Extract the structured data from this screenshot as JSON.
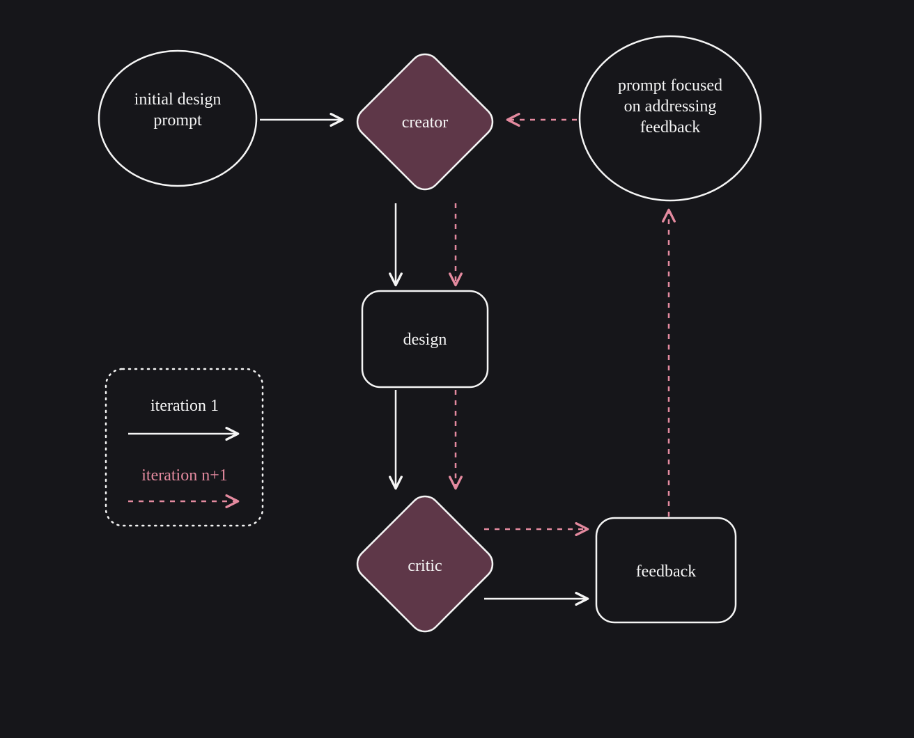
{
  "diagram": {
    "type": "flowchart",
    "background": "#16161a",
    "colors": {
      "stroke": "#f5f5f5",
      "accent_fill": "#5e3748",
      "dashed_stroke": "#e48a9f"
    },
    "nodes": {
      "initial_prompt": {
        "shape": "ellipse",
        "label": "initial design prompt",
        "fill": "none",
        "stroke": "#f5f5f5"
      },
      "creator": {
        "shape": "diamond",
        "label": "creator",
        "fill": "#5e3748",
        "stroke": "#f5f5f5"
      },
      "feedback_prompt": {
        "shape": "ellipse",
        "label": "prompt focused on addressing feedback",
        "fill": "none",
        "stroke": "#f5f5f5"
      },
      "design": {
        "shape": "rounded-rect",
        "label": "design",
        "fill": "none",
        "stroke": "#f5f5f5"
      },
      "critic": {
        "shape": "diamond",
        "label": "critic",
        "fill": "#5e3748",
        "stroke": "#f5f5f5"
      },
      "feedback": {
        "shape": "rounded-rect",
        "label": "feedback",
        "fill": "none",
        "stroke": "#f5f5f5"
      }
    },
    "edges": [
      {
        "from": "initial_prompt",
        "to": "creator",
        "style": "solid",
        "stroke": "#f5f5f5"
      },
      {
        "from": "creator",
        "to": "design",
        "style": "solid",
        "stroke": "#f5f5f5"
      },
      {
        "from": "creator",
        "to": "design",
        "style": "dashed",
        "stroke": "#e48a9f"
      },
      {
        "from": "design",
        "to": "critic",
        "style": "solid",
        "stroke": "#f5f5f5"
      },
      {
        "from": "design",
        "to": "critic",
        "style": "dashed",
        "stroke": "#e48a9f"
      },
      {
        "from": "critic",
        "to": "feedback",
        "style": "solid",
        "stroke": "#f5f5f5"
      },
      {
        "from": "critic",
        "to": "feedback",
        "style": "dashed",
        "stroke": "#e48a9f"
      },
      {
        "from": "feedback",
        "to": "feedback_prompt",
        "style": "dashed",
        "stroke": "#e48a9f"
      },
      {
        "from": "feedback_prompt",
        "to": "creator",
        "style": "dashed",
        "stroke": "#e48a9f"
      }
    ],
    "legend": {
      "box_style": "dotted",
      "items": [
        {
          "label": "iteration 1",
          "style": "solid",
          "stroke": "#f5f5f5"
        },
        {
          "label": "iteration n+1",
          "style": "dashed",
          "stroke": "#e48a9f"
        }
      ]
    }
  }
}
